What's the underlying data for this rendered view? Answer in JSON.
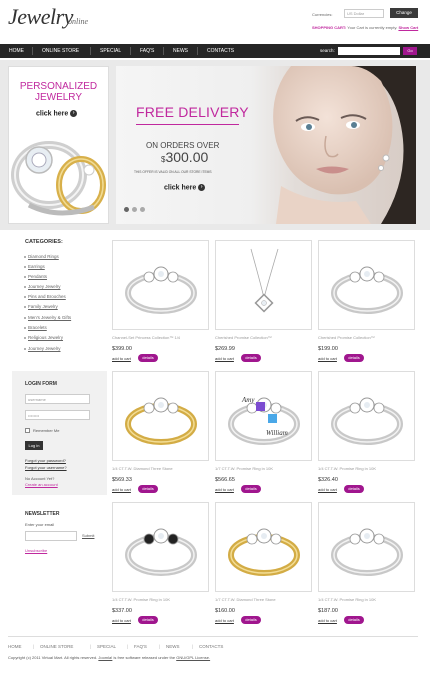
{
  "header": {
    "logo_text": "Jewelry",
    "logo_subtext": "online",
    "currency_label": "Currencies:",
    "currency_value": "US Dollar",
    "change_button": "Change",
    "cart_label": "SHOPPING CART:",
    "cart_text": "Your Cart is currently empty.",
    "cart_link": "Show Cart"
  },
  "nav": {
    "items": [
      "HOME",
      "ONLINE STORE",
      "SPECIAL",
      "FAQ'S",
      "NEWS",
      "CONTACTS"
    ],
    "search_label": "search:",
    "search_placeholder": "",
    "go_button": "Go"
  },
  "banner": {
    "left_title_1": "PERSONALIZED",
    "left_title_2": "JEWELRY",
    "left_click": "click here",
    "right_title": "FREE DELIVERY",
    "orders_over": "ON ORDERS OVER",
    "price_currency": "$",
    "price_value": "300.00",
    "offer_note": "THIS OFFER IS VALID ON ALL OUR STORE ITEMS",
    "right_click": "click here",
    "arrow": "›"
  },
  "sidebar": {
    "categories_title": "CATEGORIES:",
    "categories": [
      "Diamond Rings",
      "Earrings",
      "Pendants",
      "Journey Jewelry",
      "Pins and Brooches",
      "Family Jewelry",
      "Men's Jewelry & Gifts",
      "Bracelets",
      "Religious Jewelry",
      "Journey Jewelry"
    ],
    "login": {
      "title": "LOGIN FORM",
      "username_placeholder": "username",
      "password_placeholder": "••••••••",
      "remember_label": "Remember Me",
      "login_button": "Log in",
      "forgot_password": "Forgot your password?",
      "forgot_username": "Forgot your username?",
      "no_account": "No Account Yet?",
      "create_account": "Create an account"
    },
    "newsletter": {
      "title": "NEWSLETTER",
      "label": "Enter your email",
      "submit": "Submit",
      "unsubscribe": "Unsubscribe"
    }
  },
  "products": [
    {
      "name": "Channel-Set Princess Collection™ 1/4",
      "price": "$399.00",
      "add_to_cart": "add to cart",
      "details": "details"
    },
    {
      "name": "Cherished Promise Collection™",
      "price": "$269.99",
      "add_to_cart": "add to cart",
      "details": "details"
    },
    {
      "name": "Cherished Promise Collection™",
      "price": "$199.00",
      "add_to_cart": "add to cart",
      "details": "details"
    },
    {
      "name": "1/4 CT.T.W. Diamond Three Stone",
      "price": "$569.33",
      "add_to_cart": "add to cart",
      "details": "details"
    },
    {
      "name": "1/7 CT.T.W. Promise Ring in 10K",
      "price": "$566.65",
      "add_to_cart": "add to cart",
      "details": "details"
    },
    {
      "name": "1/4 CT.T.W. Promise Ring in 10K",
      "price": "$326.40",
      "add_to_cart": "add to cart",
      "details": "details"
    },
    {
      "name": "1/4 CT.T.W. Promise Ring in 10K",
      "price": "$337.00",
      "add_to_cart": "add to cart",
      "details": "details"
    },
    {
      "name": "1/7 CT.T.W. Diamond Three Stone",
      "price": "$160.00",
      "add_to_cart": "add to cart",
      "details": "details"
    },
    {
      "name": "1/4 CT.T.W. Promise Ring in 10K",
      "price": "$187.00",
      "add_to_cart": "add to cart",
      "details": "details"
    }
  ],
  "engraving": {
    "name_1": "Amy",
    "name_2": "William"
  },
  "footer": {
    "nav": [
      "HOME",
      "ONLINE STORE",
      "SPECIAL",
      "FAQ'S",
      "NEWS",
      "CONTACTS"
    ],
    "separator": "|",
    "copyright_pre": "Copyright (c) 2011 Virtual Mart. All rights reserved.",
    "copyright_link1": "Joomla!",
    "copyright_mid": "is free software released under the",
    "copyright_link2": "GNU/GPL License."
  },
  "colors": {
    "accent": "#c0289e",
    "button_purple": "#a0168e",
    "nav_bg": "#262626"
  }
}
